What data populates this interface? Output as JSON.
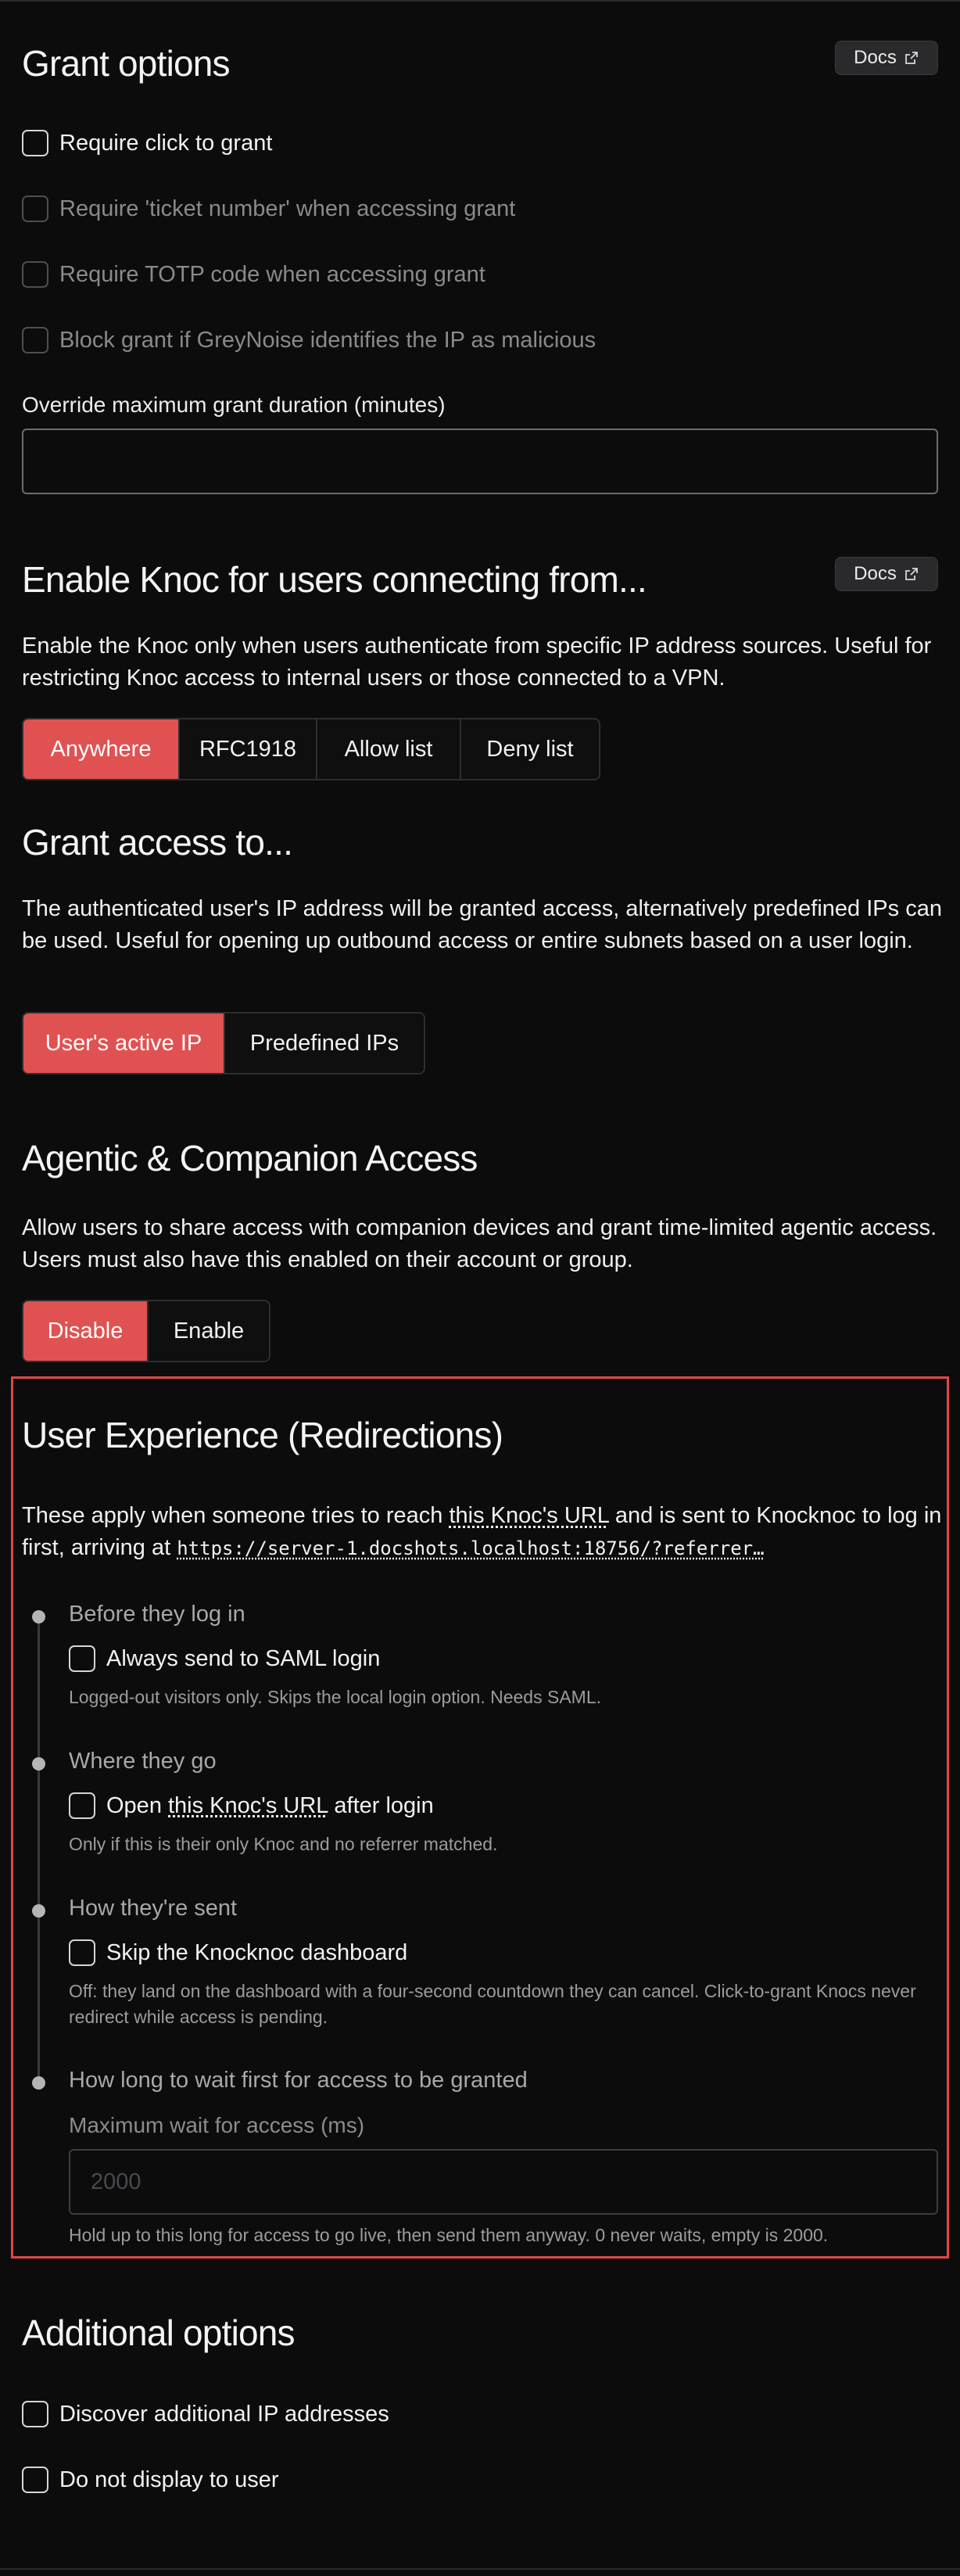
{
  "grant_options": {
    "title": "Grant options",
    "docs_label": "Docs",
    "checks": [
      {
        "label": "Require click to grant",
        "disabled": false
      },
      {
        "label": "Require 'ticket number' when accessing grant",
        "disabled": true
      },
      {
        "label": "Require TOTP code when accessing grant",
        "disabled": true
      },
      {
        "label": "Block grant if GreyNoise identifies the IP as malicious",
        "disabled": true
      }
    ],
    "override_label": "Override maximum grant duration (minutes)",
    "override_value": ""
  },
  "enable_knoc": {
    "title": "Enable Knoc for users connecting from...",
    "docs_label": "Docs",
    "description": "Enable the Knoc only when users authenticate from specific IP address sources. Useful for restricting Knoc access to internal users or those connected to a VPN.",
    "options": [
      "Anywhere",
      "RFC1918",
      "Allow list",
      "Deny list"
    ],
    "selected": "Anywhere"
  },
  "grant_access": {
    "title": "Grant access to...",
    "description": "The authenticated user's IP address will be granted access, alternatively predefined IPs can be used. Useful for opening up outbound access or entire subnets based on a user login.",
    "options": [
      "User's active IP",
      "Predefined IPs"
    ],
    "selected": "User's active IP"
  },
  "agentic": {
    "title": "Agentic & Companion Access",
    "description": "Allow users to share access with companion devices and grant time-limited agentic access. Users must also have this enabled on their account or group.",
    "options": [
      "Disable",
      "Enable"
    ],
    "selected": "Disable"
  },
  "user_experience": {
    "title": "User Experience (Redirections)",
    "intro_1": "These apply when someone tries to reach ",
    "intro_link": "this Knoc's URL",
    "intro_2": " and is sent to Knocknoc to log in first, arriving at ",
    "intro_url": "https://server-1.docshots.localhost:18756/?referrer…",
    "steps": [
      {
        "label": "Before they log in",
        "check": "Always send to SAML login",
        "help": "Logged-out visitors only. Skips the local login option. Needs SAML."
      },
      {
        "label": "Where they go",
        "check_pre": "Open ",
        "check_link": "this Knoc's URL",
        "check_post": " after login",
        "help": "Only if this is their only Knoc and no referrer matched."
      },
      {
        "label": "How they're sent",
        "check": "Skip the Knocknoc dashboard",
        "help": "Off: they land on the dashboard with a four-second countdown they can cancel. Click-to-grant Knocs never redirect while access is pending."
      },
      {
        "label": "How long to wait first for access to be granted",
        "field_label": "Maximum wait for access (ms)",
        "placeholder": "2000",
        "help": "Hold up to this long for access to go live, then send them anyway. 0 never waits, empty is 2000."
      }
    ]
  },
  "additional": {
    "title": "Additional options",
    "checks": [
      "Discover additional IP addresses",
      "Do not display to user"
    ]
  },
  "colors": {
    "accent": "#e05252",
    "highlight_border": "#e24646",
    "background": "#0c0c0d"
  }
}
